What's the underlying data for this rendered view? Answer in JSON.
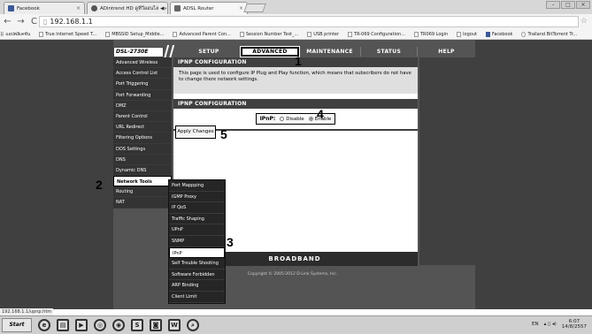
{
  "browser": {
    "tabs": [
      {
        "label": "Facebook"
      },
      {
        "label": "ADintrend HD ดูทีวีออนไล ◀»"
      },
      {
        "label": "ADSL Router"
      }
    ],
    "url": "192.168.1.1",
    "bookmarks": [
      {
        "label": "แอปพลิเคชัน"
      },
      {
        "label": "True Internet Speed T..."
      },
      {
        "label": "MBSSID Setup_Middle..."
      },
      {
        "label": "Advanced Parent Con..."
      },
      {
        "label": "Session Number Test_..."
      },
      {
        "label": "USB printer"
      },
      {
        "label": "TR-069 Configuration..."
      },
      {
        "label": "TR069 Login"
      },
      {
        "label": "logout"
      },
      {
        "label": "Facebook"
      },
      {
        "label": "Trailand BitTorrent Tr..."
      }
    ],
    "status_url": "192.168.1.1/upnp.htm"
  },
  "router": {
    "model": "DSL-2730E",
    "topnav": [
      {
        "label": "SETUP"
      },
      {
        "label": "ADVANCED"
      },
      {
        "label": "MAINTENANCE"
      },
      {
        "label": "STATUS"
      },
      {
        "label": "HELP"
      }
    ],
    "sidebar": [
      {
        "label": "Advanced Wireless"
      },
      {
        "label": "Access Control List"
      },
      {
        "label": "Port Triggering"
      },
      {
        "label": "Port Forwarding"
      },
      {
        "label": "DMZ"
      },
      {
        "label": "Parent Control"
      },
      {
        "label": "URL Redirect"
      },
      {
        "label": "Filtering Options"
      },
      {
        "label": "DOS Settings"
      },
      {
        "label": "DNS"
      },
      {
        "label": "Dynamic DNS"
      },
      {
        "label": "Network Tools"
      },
      {
        "label": "Routing"
      },
      {
        "label": "NAT"
      }
    ],
    "submenu": [
      {
        "label": "Port Mappping"
      },
      {
        "label": "IGMP Proxy"
      },
      {
        "label": "IP QoS"
      },
      {
        "label": "Traffic Shaping"
      },
      {
        "label": "UPnP"
      },
      {
        "label": "SNMP"
      },
      {
        "label": "IPnP"
      },
      {
        "label": "Self Trouble Shooting"
      },
      {
        "label": "Software Forbidden"
      },
      {
        "label": "ARP Binding"
      },
      {
        "label": "Client Limit"
      }
    ],
    "section1_title": "IPNP CONFIGURATION",
    "section1_desc": "This page is used to configure IP Plug and Play function, which means that subscribers do not have to change there network settings.",
    "section2_title": "IPNP CONFIGURATION",
    "ipnp_label": "IPnP:",
    "option_disable": "Disable",
    "option_enable": "Enable",
    "selected_option": "Enable",
    "apply_label": "Apply Changes",
    "footer_brand": "BROADBAND",
    "copyright": "Copyright © 2005-2012 D-Link Systems, Inc."
  },
  "steps": [
    "1",
    "2",
    "3",
    "4",
    "5"
  ],
  "taskbar": {
    "start": "Start",
    "lang": "EN",
    "time": "6:07",
    "date": "14/8/2557"
  }
}
